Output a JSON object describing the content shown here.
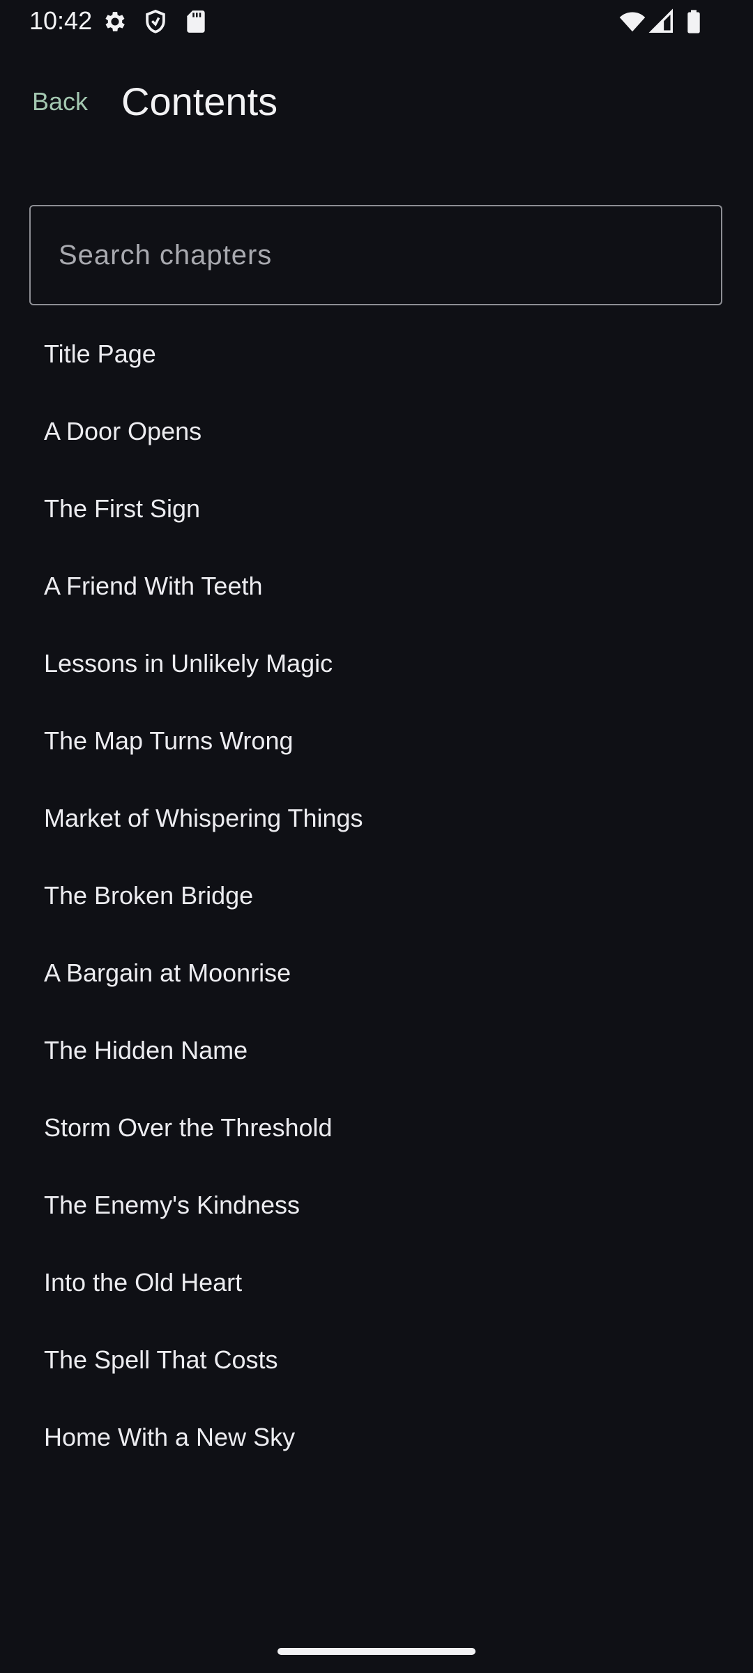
{
  "status_bar": {
    "time": "10:42",
    "icons_left": [
      "gear-icon",
      "shield-icon",
      "sd-card-icon"
    ],
    "icons_right": [
      "wifi-icon",
      "cellular-signal-icon",
      "battery-icon"
    ]
  },
  "header": {
    "back_label": "Back",
    "title": "Contents"
  },
  "search": {
    "placeholder": "Search chapters",
    "value": ""
  },
  "chapters": [
    "Title Page",
    "A Door Opens",
    "The First Sign",
    "A Friend With Teeth",
    "Lessons in Unlikely Magic",
    "The Map Turns Wrong",
    "Market of Whispering Things",
    "The Broken Bridge",
    "A Bargain at Moonrise",
    "The Hidden Name",
    "Storm Over the Threshold",
    "The Enemy's Kindness",
    "Into the Old Heart",
    "The Spell That Costs",
    "Home With a New Sky"
  ],
  "colors": {
    "background": "#0f1015",
    "accent": "#a3c7b0",
    "text": "#ececf0",
    "border": "#8d8e94"
  }
}
